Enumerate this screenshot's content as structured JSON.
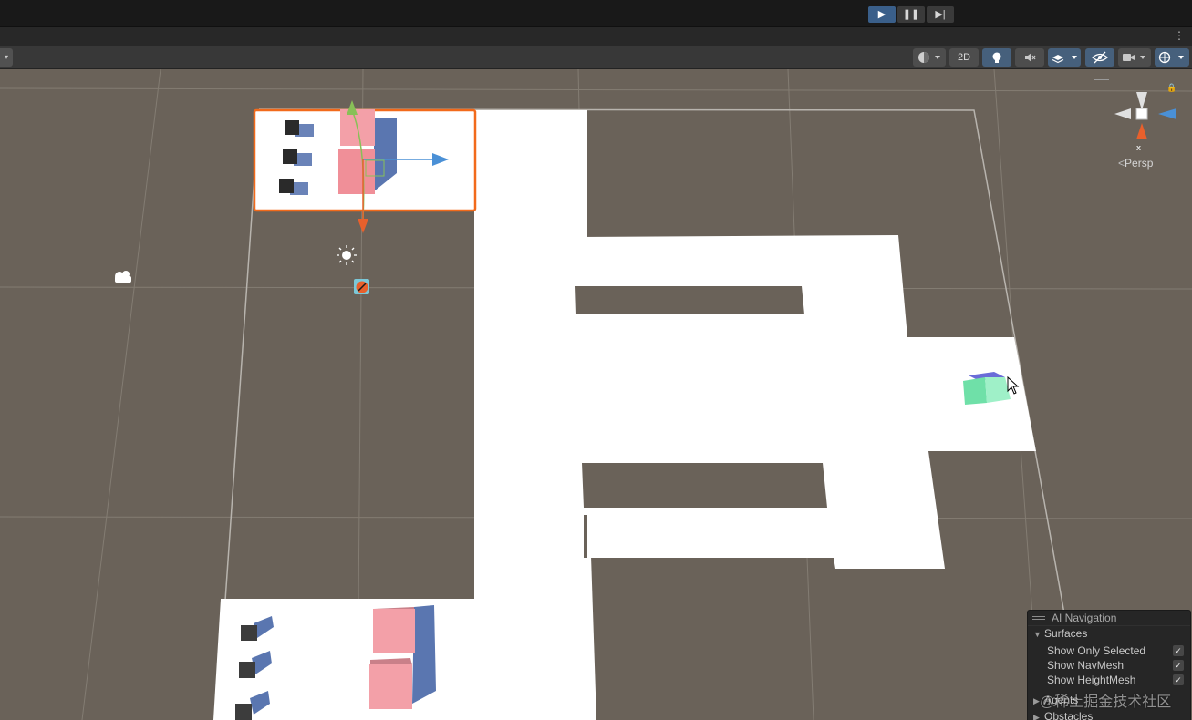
{
  "playbar": {
    "play_icon": "play-icon",
    "pause_icon": "pause-icon",
    "step_icon": "step-icon",
    "play_glyph": "▶",
    "pause_glyph": "❚❚",
    "step_glyph": "▶|"
  },
  "tabstrip": {
    "more_glyph": "⋮"
  },
  "toolbar": {
    "draw_mode_icon": "shading-sphere-icon",
    "mode_2d_label": "2D",
    "lighting_icon": "lightbulb-icon",
    "audio_icon": "audio-muted-icon",
    "effects_icon": "effects-layers-icon",
    "visibility_icon": "hidden-eye-icon",
    "camera_icon": "camera-icon",
    "gizmos_icon": "gizmos-globe-icon",
    "left_dropdown_glyph": "▾"
  },
  "gizmo": {
    "axis_label": "x",
    "persp_arrow": "<",
    "persp_label": "Persp",
    "lock_icon": "lock-icon"
  },
  "ai_navigation": {
    "title": "AI Navigation",
    "surfaces": "Surfaces",
    "options": [
      {
        "label": "Show Only Selected",
        "checked": true
      },
      {
        "label": "Show NavMesh",
        "checked": true
      },
      {
        "label": "Show HeightMesh",
        "checked": true
      }
    ],
    "agents": "Agents",
    "obstacles": "Obstacles",
    "expanded_glyph": "▼",
    "collapsed_glyph": "▶",
    "check_glyph": "✓"
  },
  "watermark": "@稀土掘金技术社区",
  "colors": {
    "ground": "#6a6259",
    "navmesh": "#ffffff",
    "selection_outline": "#f26a1b",
    "pink_cube": "#f3a0a8",
    "dark_cube": "#2a2a2a",
    "shadow": "#5a76b0",
    "agent_cube": "#6fe0a8",
    "axis_y": "#88c057",
    "axis_x": "#e8602c",
    "axis_z": "#4a90d6"
  }
}
